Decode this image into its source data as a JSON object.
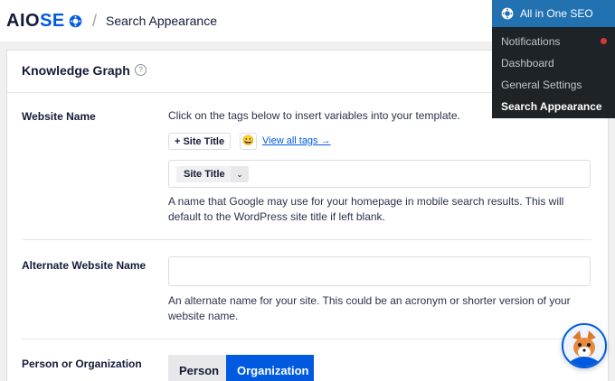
{
  "header": {
    "logo_prefix": "AIO",
    "logo_suffix": "SE",
    "breadcrumb_separator": "/",
    "breadcrumb": "Search Appearance"
  },
  "card": {
    "title": "Knowledge Graph",
    "help_glyph": "?"
  },
  "website_name": {
    "label": "Website Name",
    "hint": "Click on the tags below to insert variables into your template.",
    "tag_button": "Site Title",
    "tag_button_prefix": "+",
    "emoji": "😀",
    "view_all_link": "View all tags →",
    "chip_value": "Site Title",
    "chip_caret": "⌄",
    "description_line1": "A name that Google may use for your homepage in mobile search results. This will",
    "description_line2": "default to the WordPress site title if left blank."
  },
  "alternate_name": {
    "label": "Alternate Website Name",
    "value": "",
    "description_line1": "An alternate name for your site. This could be an acronym or shorter version of your",
    "description_line2": "website name."
  },
  "person_or_org": {
    "label": "Person or Organization",
    "options": [
      "Person",
      "Organization"
    ],
    "selected": "Organization"
  },
  "admin_menu": {
    "title": "All in One SEO",
    "items": [
      "Notifications",
      "Dashboard",
      "General Settings",
      "Search Appearance"
    ],
    "active_item": "Search Appearance"
  },
  "colors": {
    "brand_blue": "#005ae0",
    "admin_dark": "#1d2327",
    "admin_blue": "#2271b1",
    "notification_red": "#d63638"
  },
  "icons": [
    "aioseo-cog-icon",
    "help-icon",
    "emoji-icon",
    "chevron-down-icon",
    "aioseo-admin-icon",
    "mascot-icon"
  ]
}
